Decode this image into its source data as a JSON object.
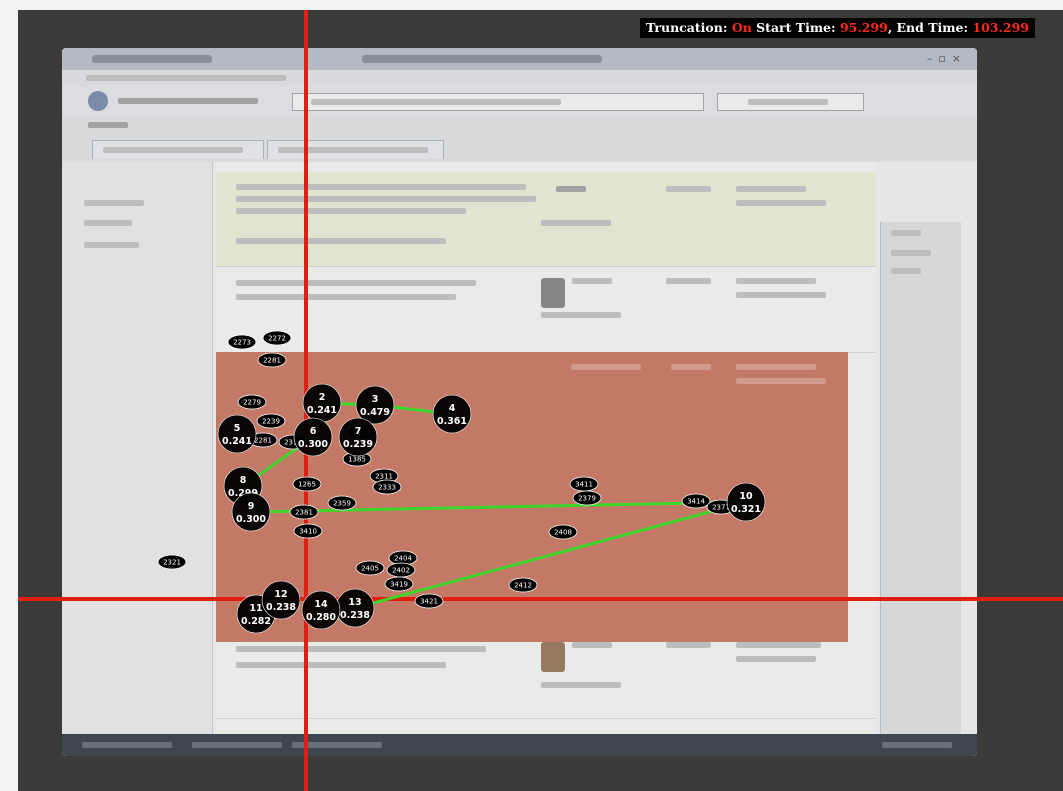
{
  "hud": {
    "truncation_label": "Truncation:",
    "truncation_value": "On",
    "start_label": "Start Time:",
    "start_value": "95.299",
    "end_label": ", End Time:",
    "end_value": "103.299"
  },
  "colors": {
    "hud_value": "#ff2a1a",
    "crosshair": "#e11e10",
    "scanpath": "#3ed62a",
    "fixation": "#000000",
    "highlight_row": "#cc7d68"
  },
  "fixations": [
    {
      "label": "2",
      "value": "0.241"
    },
    {
      "label": "3",
      "value": "0.479"
    },
    {
      "label": "4",
      "value": "0.361"
    },
    {
      "label": "5",
      "value": "0.241"
    },
    {
      "label": "6",
      "value": "0.300"
    },
    {
      "label": "7",
      "value": "0.239"
    },
    {
      "label": "8",
      "value": "0.299"
    },
    {
      "label": "9",
      "value": "0.300"
    },
    {
      "label": "10",
      "value": "0.321"
    },
    {
      "label": "11",
      "value": "0.282"
    },
    {
      "label": "12",
      "value": "0.238"
    },
    {
      "label": "13",
      "value": "0.238"
    },
    {
      "label": "14",
      "value": "0.280"
    }
  ],
  "minor_tags": [
    "2273",
    "2272",
    "2281",
    "2279",
    "2239",
    "2281",
    "2312",
    "2309",
    "1385",
    "2311",
    "2333",
    "1265",
    "2359",
    "3411",
    "2379",
    "2381",
    "3414",
    "2377",
    "2408",
    "2321",
    "2405",
    "2404",
    "2402",
    "3419",
    "3421",
    "2412",
    "3410"
  ]
}
